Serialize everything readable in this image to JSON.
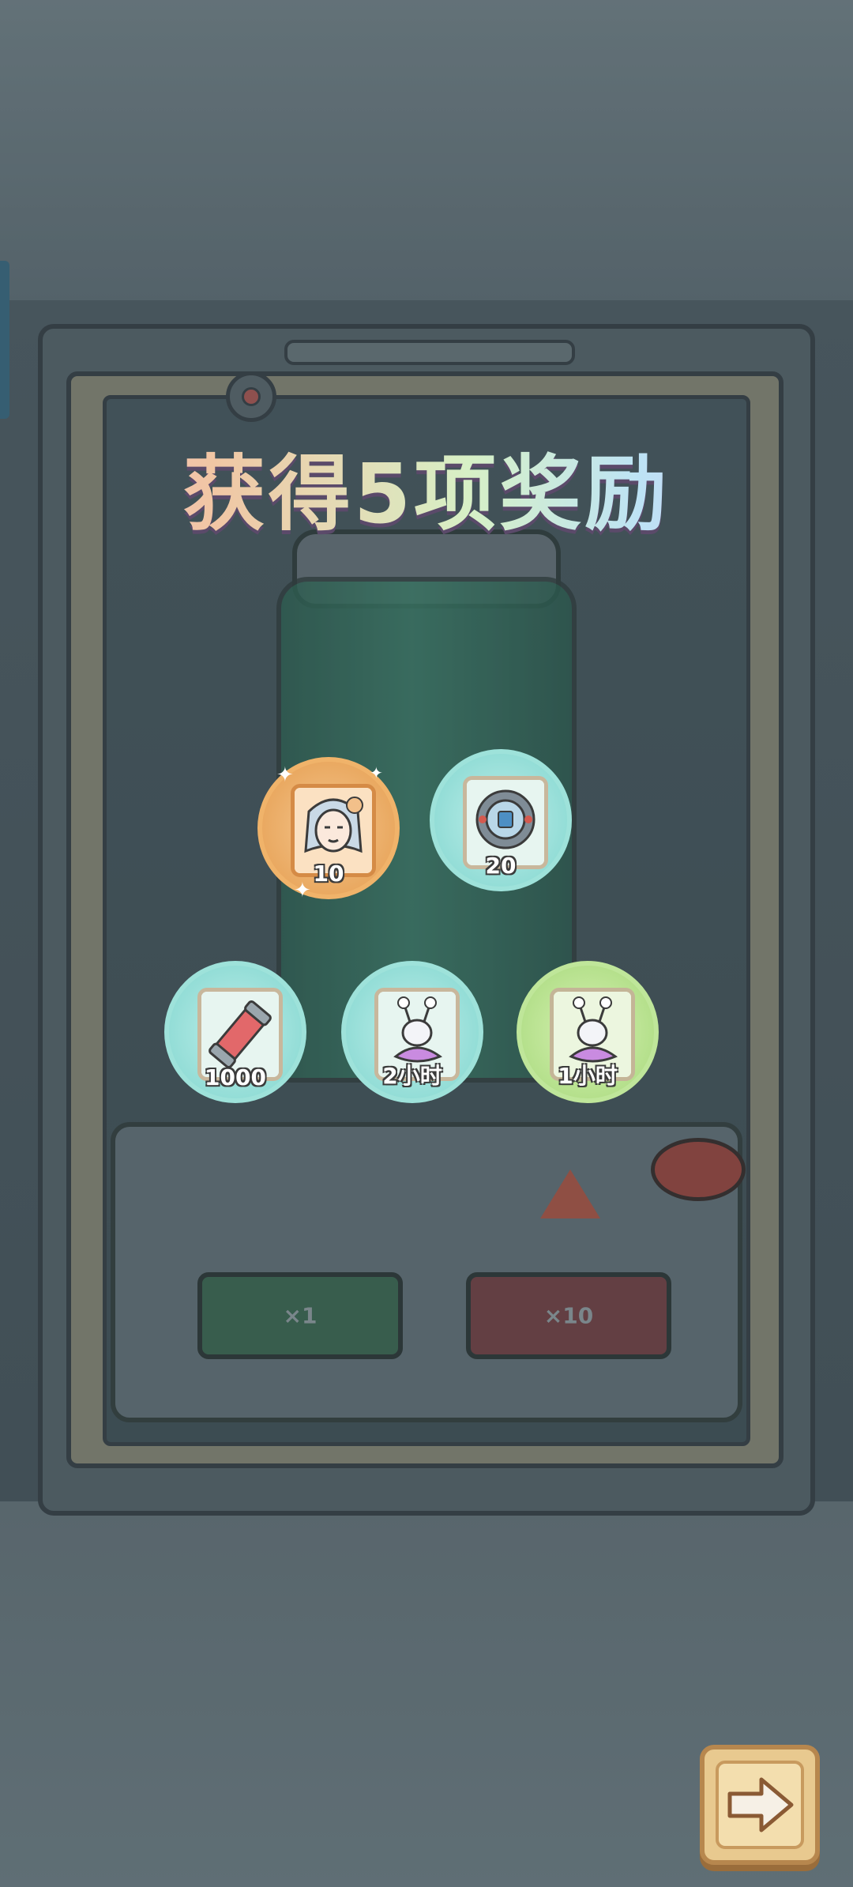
{
  "title": "获得5项奖励",
  "rewards": [
    {
      "amount": "10",
      "icon": "character-card-icon",
      "rarity": "orange"
    },
    {
      "amount": "20",
      "icon": "compass-gear-icon",
      "rarity": "cyan"
    },
    {
      "amount": "1000",
      "icon": "energy-capsule-icon",
      "rarity": "cyan"
    },
    {
      "amount": "2小时",
      "icon": "snail-icon",
      "rarity": "cyan"
    },
    {
      "amount": "1小时",
      "icon": "snail-icon",
      "rarity": "green"
    }
  ],
  "console": {
    "left_button": "×1",
    "right_button": "×10"
  },
  "next_icon": "arrow-right-icon",
  "colors": {
    "orange": "#e59d4f",
    "cyan": "#82d6cf",
    "green": "#a7d97c",
    "title_gradient": [
      "#f4b9cf",
      "#d7f0c6",
      "#d6b7f4"
    ]
  }
}
